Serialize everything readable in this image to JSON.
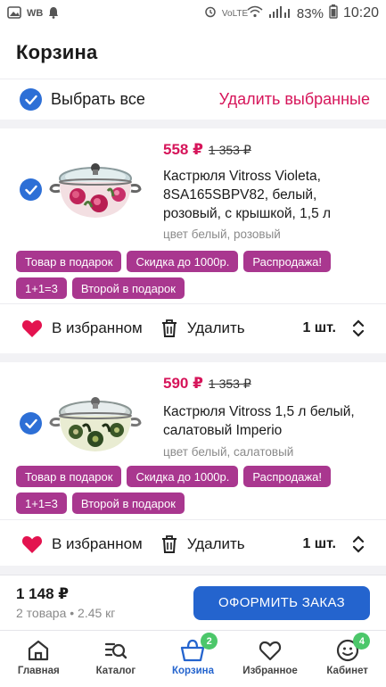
{
  "status_bar": {
    "carrier": "WB",
    "battery": "83%",
    "time": "10:20",
    "volte": "VoLTE"
  },
  "header": {
    "title": "Корзина"
  },
  "select_all": {
    "label": "Выбрать все",
    "delete_label": "Удалить выбранные"
  },
  "items": [
    {
      "price": "558 ₽",
      "old_price": "1 353 ₽",
      "name": "Кастрюля Vitross Violeta, 8SA165SBPV82, белый, розовый, с крышкой, 1,5 л",
      "color": "цвет белый, розовый",
      "tags": [
        "Товар в подарок",
        "Скидка до 1000р.",
        "Распродажа!",
        "1+1=3",
        "Второй в подарок"
      ],
      "favorite_label": "В избранном",
      "delete_label": "Удалить",
      "qty": "1 шт."
    },
    {
      "price": "590 ₽",
      "old_price": "1 353 ₽",
      "name": "Кастрюля Vitross 1,5 л белый, салатовый Imperio",
      "color": "цвет белый, салатовый",
      "tags": [
        "Товар в подарок",
        "Скидка до 1000р.",
        "Распродажа!",
        "1+1=3",
        "Второй в подарок"
      ],
      "favorite_label": "В избранном",
      "delete_label": "Удалить",
      "qty": "1 шт."
    }
  ],
  "checkout": {
    "total": "1 148 ₽",
    "meta": "2 товара • 2.45 кг",
    "button": "ОФОРМИТЬ ЗАКАЗ"
  },
  "nav": [
    {
      "label": "Главная",
      "icon": "home-icon"
    },
    {
      "label": "Каталог",
      "icon": "catalog-search-icon"
    },
    {
      "label": "Корзина",
      "icon": "cart-icon",
      "badge": "2",
      "active": true
    },
    {
      "label": "Избранное",
      "icon": "heart-icon"
    },
    {
      "label": "Кабинет",
      "icon": "profile-icon",
      "badge": "4"
    }
  ],
  "colors": {
    "accent": "#2464ce",
    "price": "#d6155a",
    "tag": "#a9378f",
    "badge": "#4cc76a"
  }
}
